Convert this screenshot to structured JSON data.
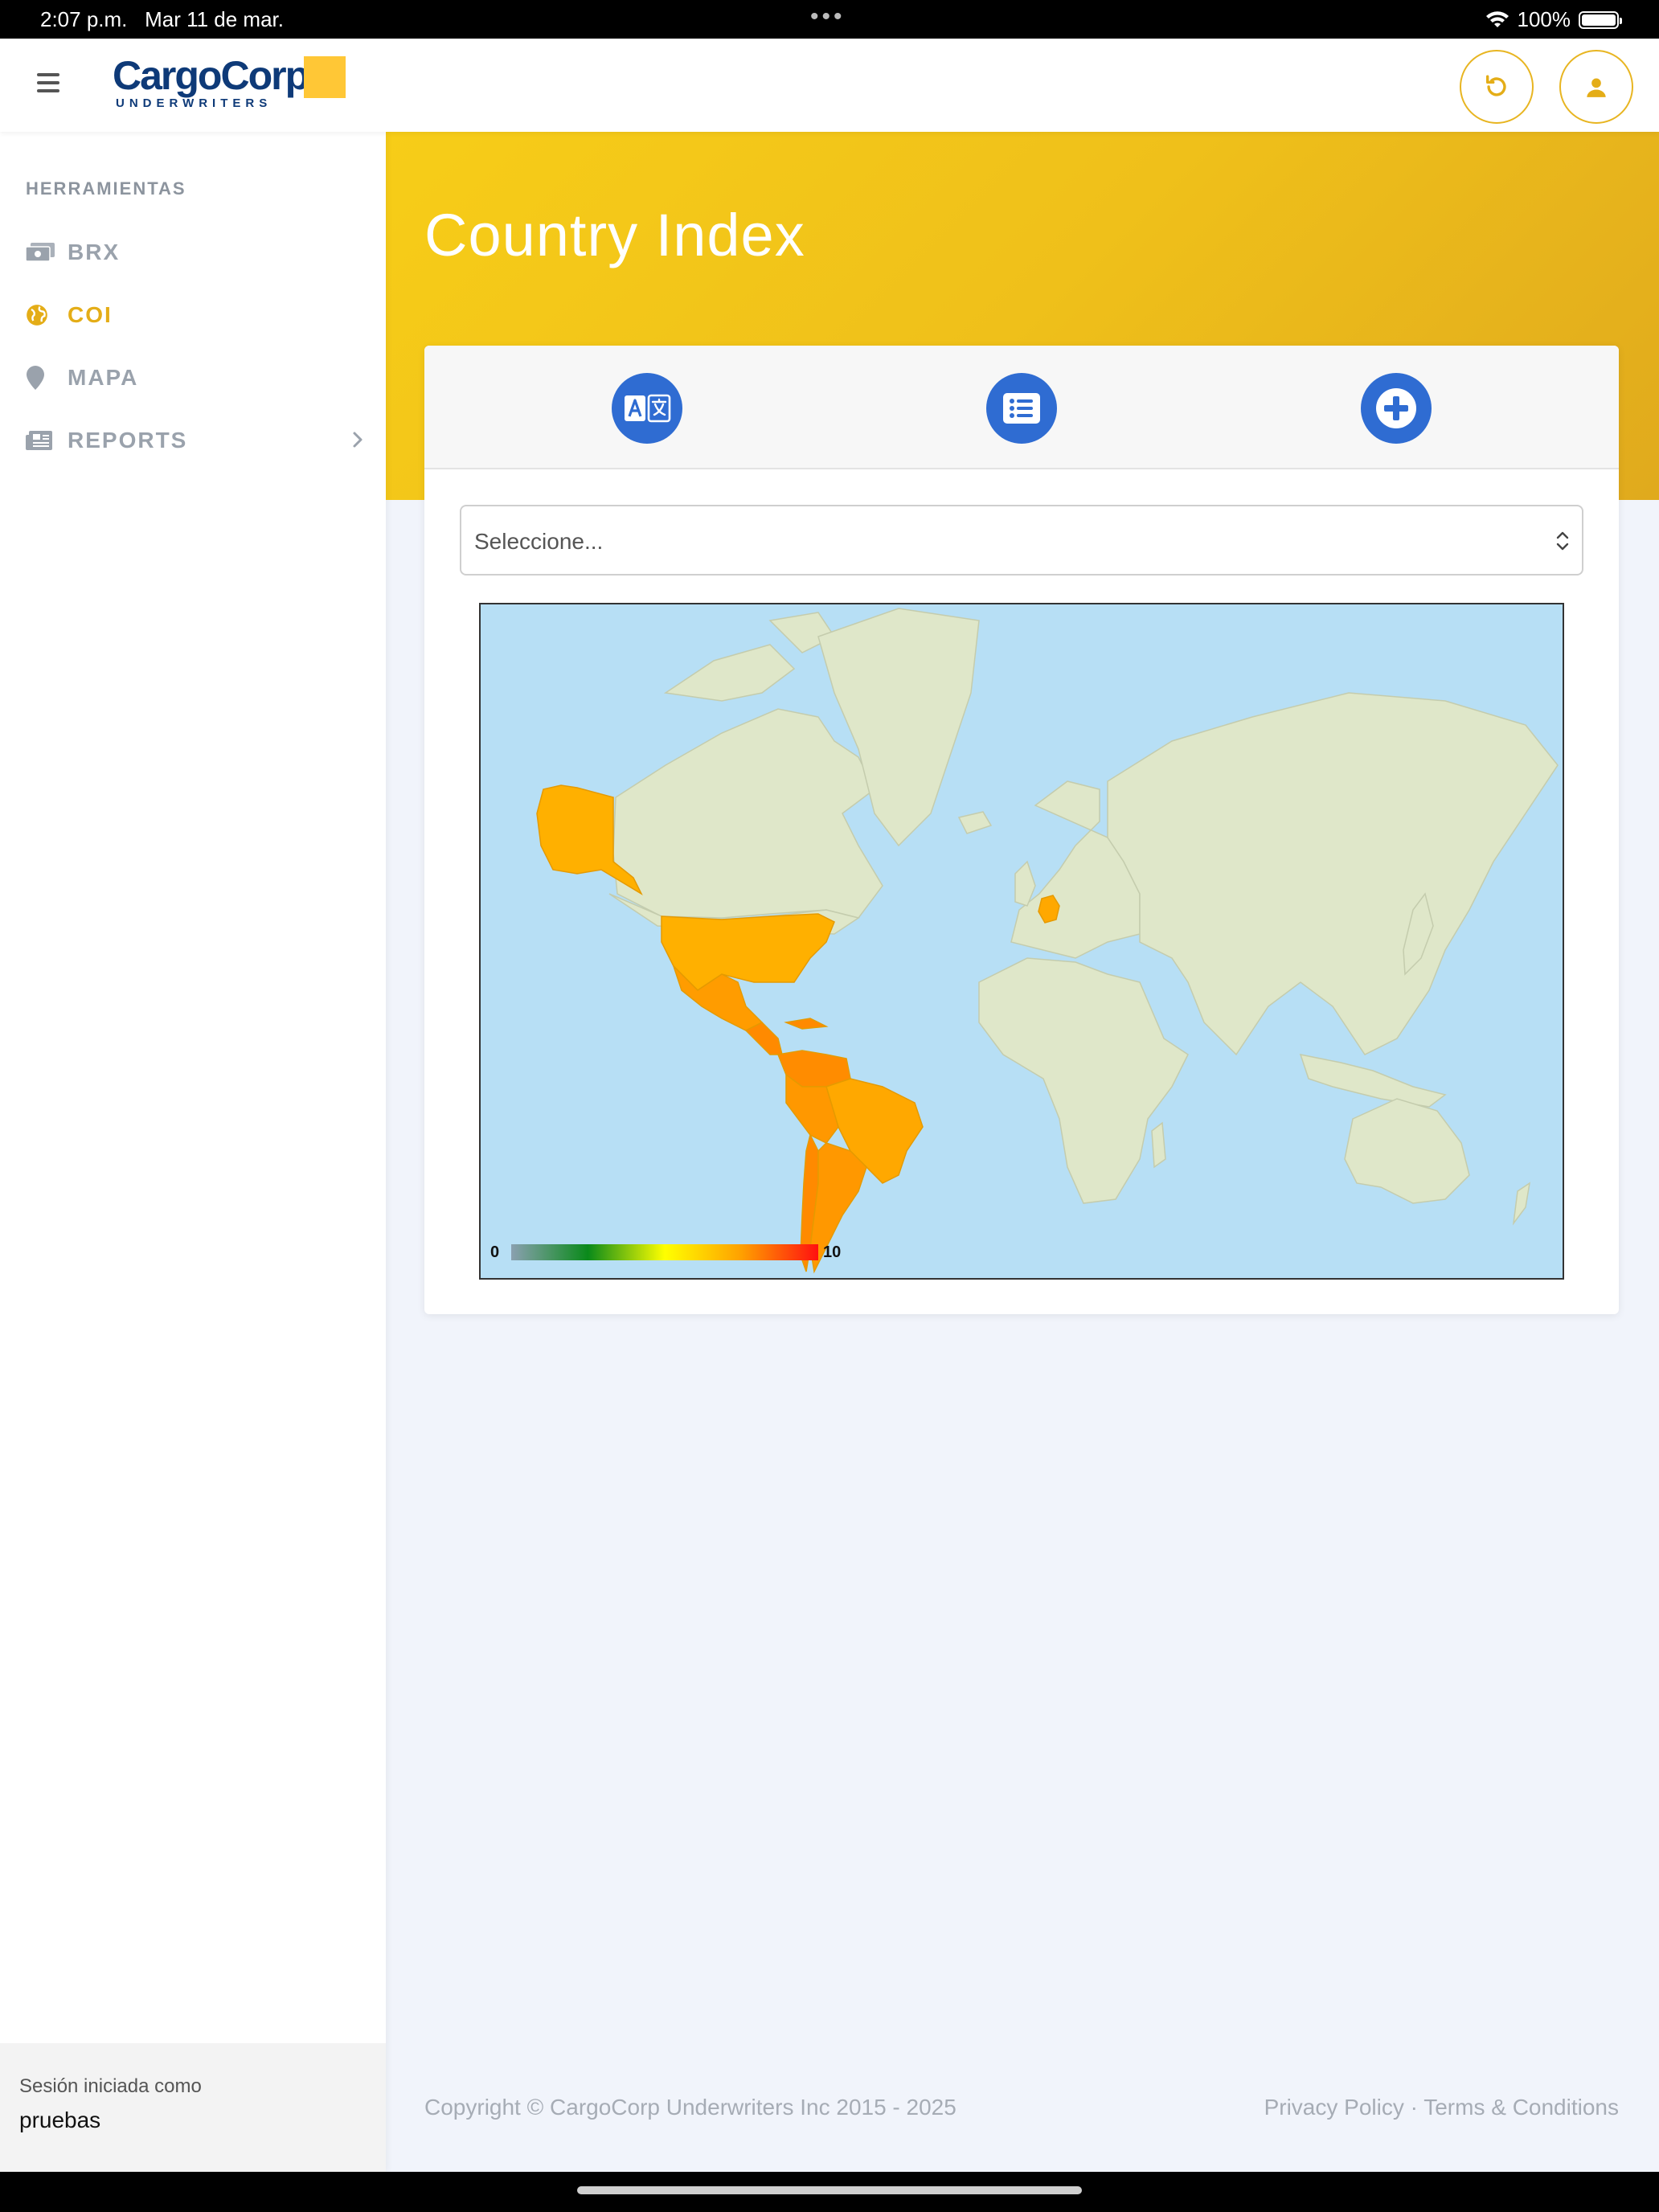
{
  "status_bar": {
    "time": "2:07 p.m.",
    "date": "Mar 11 de mar.",
    "battery": "100%"
  },
  "header": {
    "logo_name": "CargoCorp",
    "logo_sub": "UNDERWRITERS"
  },
  "sidebar": {
    "section_label": "HERRAMIENTAS",
    "items": [
      {
        "label": "BRX",
        "icon": "money-icon"
      },
      {
        "label": "COI",
        "icon": "globe-icon",
        "active": true
      },
      {
        "label": "MAPA",
        "icon": "map-pin-icon"
      },
      {
        "label": "REPORTS",
        "icon": "newspaper-icon"
      }
    ],
    "session_label": "Sesión iniciada como",
    "session_user": "pruebas"
  },
  "main": {
    "title": "Country Index",
    "select_placeholder": "Seleccione...",
    "legend_min": "0",
    "legend_max": "10"
  },
  "footer": {
    "copyright": "Copyright © CargoCorp Underwriters Inc 2015 - 2025",
    "privacy": "Privacy Policy",
    "separator": "·",
    "terms": "Terms & Conditions"
  },
  "colors": {
    "accent": "#e4ad17",
    "tool_blue": "#2f6cd2",
    "ocean": "#b7dff5",
    "land": "#dfe7c9",
    "highlight": "#ffb000"
  }
}
